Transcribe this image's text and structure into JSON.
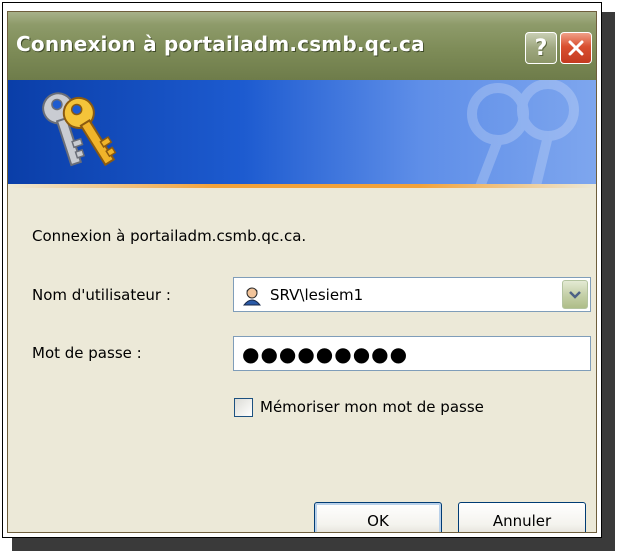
{
  "window": {
    "title": "Connexion à portailadm.csmb.qc.ca",
    "help_label": "?",
    "close_label": "✕"
  },
  "dialog": {
    "prompt": "Connexion à portailadm.csmb.qc.ca.",
    "username_label": "Nom d'utilisateur :",
    "username_value": "SRV\\lesiem1",
    "password_label": "Mot de passe :",
    "password_mask": "●●●●●●●●●",
    "remember_label": "Mémoriser mon mot de passe",
    "remember_checked": false
  },
  "buttons": {
    "ok_label": "OK",
    "cancel_label": "Annuler"
  },
  "icons": {
    "banner": "keys-icon",
    "user": "user-icon",
    "dropdown": "chevron-down-icon"
  },
  "colors": {
    "titlebar": "#7e8c58",
    "banner": "#1d5bd0",
    "accent_stripe": "#f2a23a",
    "dialog_bg": "#ece9d8"
  }
}
